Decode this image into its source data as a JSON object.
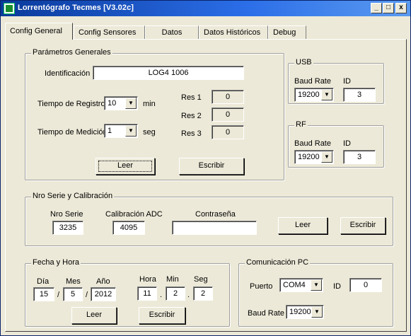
{
  "window": {
    "title": "Lorrentógrafo Tecmes [V3.02c]"
  },
  "titlebar_buttons": {
    "minimize": "_",
    "maximize": "□",
    "close": "x"
  },
  "tabs": [
    {
      "label": "Config General"
    },
    {
      "label": "Config Sensores"
    },
    {
      "label": "Datos"
    },
    {
      "label": "Datos Históricos"
    },
    {
      "label": "Debug"
    }
  ],
  "general": {
    "title": "Parámetros Generales",
    "identificacion_label": "Identificación",
    "identificacion_value": "LOG4 1006",
    "tiempo_registro_label": "Tiempo de Registro",
    "tiempo_registro_value": "10",
    "tiempo_registro_unit": "min",
    "tiempo_medicion_label": "Tiempo de Medición",
    "tiempo_medicion_value": "1",
    "tiempo_medicion_unit": "seg",
    "res1_label": "Res 1",
    "res1_value": "0",
    "res2_label": "Res 2",
    "res2_value": "0",
    "res3_label": "Res 3",
    "res3_value": "0",
    "leer_button": "Leer",
    "escribir_button": "Escribir"
  },
  "usb": {
    "title": "USB",
    "baud_label": "Baud Rate",
    "baud_value": "19200",
    "id_label": "ID",
    "id_value": "3"
  },
  "rf": {
    "title": "RF",
    "baud_label": "Baud Rate",
    "baud_value": "19200",
    "id_label": "ID",
    "id_value": "3"
  },
  "serie": {
    "title": "Nro Serie y Calibración",
    "nro_serie_label": "Nro Serie",
    "nro_serie_value": "3235",
    "calibracion_label": "Calibración ADC",
    "calibracion_value": "4095",
    "contrasena_label": "Contraseña",
    "contrasena_value": "",
    "leer_button": "Leer",
    "escribir_button": "Escribir"
  },
  "fecha": {
    "title": "Fecha y Hora",
    "dia_label": "Día",
    "dia_value": "15",
    "mes_label": "Mes",
    "mes_value": "5",
    "ano_label": "Año",
    "ano_value": "2012",
    "sep1": "/",
    "sep2": "/",
    "hora_label": "Hora",
    "hora_value": "11",
    "min_label": "Min",
    "min_value": "2",
    "seg_label": "Seg",
    "seg_value": "2",
    "tsep1": ".",
    "tsep2": ".",
    "leer_button": "Leer",
    "escribir_button": "Escribir"
  },
  "comunicacion": {
    "title": "Comunicación PC",
    "puerto_label": "Puerto",
    "puerto_value": "COM4",
    "id_label": "ID",
    "id_value": "0",
    "baud_label": "Baud Rate",
    "baud_value": "19200"
  },
  "colors": {
    "face": "#ece9d8",
    "title_start": "#0a3a9c",
    "title_end": "#5a9af0"
  },
  "icons": {
    "dropdown": "▼"
  }
}
